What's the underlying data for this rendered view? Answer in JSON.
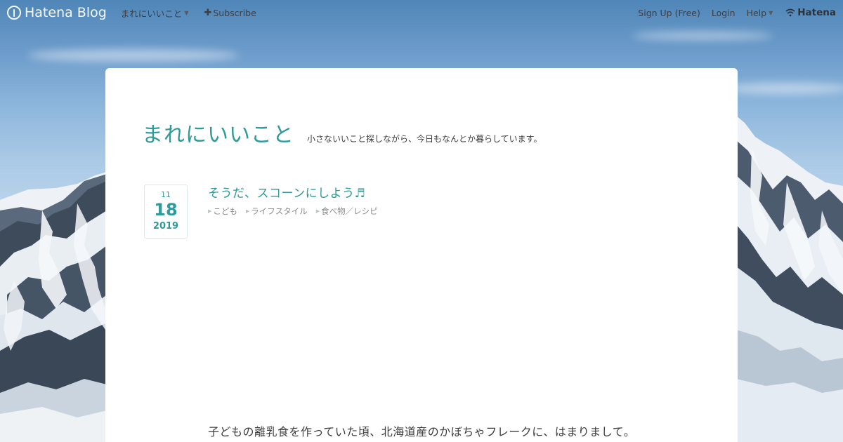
{
  "topbar": {
    "brand": "Hatena Blog",
    "blog_menu": "まれにいいこと",
    "subscribe": "Subscribe",
    "signup": "Sign Up (Free)",
    "login": "Login",
    "help": "Help",
    "hatena": "Hatena"
  },
  "blog": {
    "title": "まれにいいこと",
    "description": "小さないいこと探しながら、今日もなんとか暮らしています。"
  },
  "entry": {
    "date": {
      "month": "11",
      "day": "18",
      "year": "2019"
    },
    "title": "そうだ、スコーンにしよう♬",
    "categories": [
      "こども",
      "ライフスタイル",
      "食べ物／レシピ"
    ],
    "body_first_line": "子どもの離乳食を作っていた頃、北海道産のかぼちゃフレークに、はまりまして。"
  },
  "colors": {
    "accent": "#2e9a9a",
    "card_bg": "#ffffff",
    "text": "#3c3c3c"
  },
  "icons": {
    "brand": "hatena-blog-logo-icon",
    "blog_menu_caret": "caret-down-icon",
    "subscribe": "plus-icon",
    "help_caret": "caret-down-icon",
    "hatena": "hatena-logo-icon",
    "category_marker": "triangle-right-icon"
  }
}
